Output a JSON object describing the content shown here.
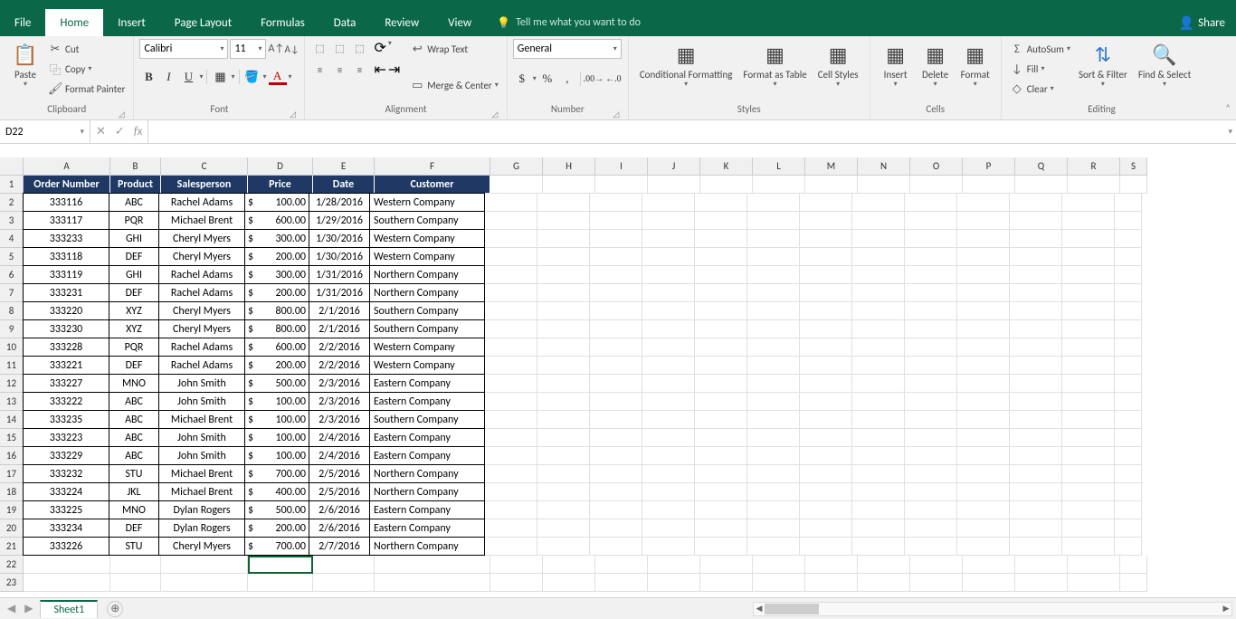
{
  "tabs": {
    "file": "File",
    "home": "Home",
    "insert": "Insert",
    "pagelayout": "Page Layout",
    "formulas": "Formulas",
    "data": "Data",
    "review": "Review",
    "view": "View",
    "tellme": "Tell me what you want to do",
    "share": "Share"
  },
  "ribbon": {
    "clipboard": {
      "paste": "Paste",
      "cut": "Cut",
      "copy": "Copy",
      "fp": "Format Painter",
      "label": "Clipboard"
    },
    "font": {
      "name": "Calibri",
      "size": "11",
      "label": "Font"
    },
    "alignment": {
      "wrap": "Wrap Text",
      "merge": "Merge & Center",
      "label": "Alignment"
    },
    "number": {
      "format": "General",
      "label": "Number"
    },
    "styles": {
      "cf": "Conditional Formatting",
      "fat": "Format as Table",
      "cs": "Cell Styles",
      "label": "Styles"
    },
    "cells": {
      "insert": "Insert",
      "delete": "Delete",
      "format": "Format",
      "label": "Cells"
    },
    "editing": {
      "autosum": "AutoSum",
      "fill": "Fill",
      "clear": "Clear",
      "sort": "Sort & Filter",
      "find": "Find & Select",
      "label": "Editing"
    }
  },
  "nameBox": "D22",
  "columns": [
    "A",
    "B",
    "C",
    "D",
    "E",
    "F",
    "G",
    "H",
    "I",
    "J",
    "K",
    "L",
    "M",
    "N",
    "O",
    "P",
    "Q",
    "R",
    "S"
  ],
  "colWidths": [
    "wA",
    "wB",
    "wC",
    "wD",
    "wE",
    "wF",
    "wG",
    "wH",
    "wI",
    "wJ",
    "wK",
    "wL",
    "wM",
    "wN",
    "wO",
    "wP",
    "wQ",
    "wR",
    "wS"
  ],
  "headers": [
    "Order Number",
    "Product",
    "Salesperson",
    "Price",
    "Date",
    "Customer"
  ],
  "rows": [
    {
      "n": "333116",
      "p": "ABC",
      "s": "Rachel Adams",
      "pr": "100.00",
      "d": "1/28/2016",
      "c": "Western Company"
    },
    {
      "n": "333117",
      "p": "PQR",
      "s": "Michael Brent",
      "pr": "600.00",
      "d": "1/29/2016",
      "c": "Southern Company"
    },
    {
      "n": "333233",
      "p": "GHI",
      "s": "Cheryl Myers",
      "pr": "300.00",
      "d": "1/30/2016",
      "c": "Western Company"
    },
    {
      "n": "333118",
      "p": "DEF",
      "s": "Cheryl Myers",
      "pr": "200.00",
      "d": "1/30/2016",
      "c": "Western Company"
    },
    {
      "n": "333119",
      "p": "GHI",
      "s": "Rachel Adams",
      "pr": "300.00",
      "d": "1/31/2016",
      "c": "Northern Company"
    },
    {
      "n": "333231",
      "p": "DEF",
      "s": "Rachel Adams",
      "pr": "200.00",
      "d": "1/31/2016",
      "c": "Northern Company"
    },
    {
      "n": "333220",
      "p": "XYZ",
      "s": "Cheryl Myers",
      "pr": "800.00",
      "d": "2/1/2016",
      "c": "Southern Company"
    },
    {
      "n": "333230",
      "p": "XYZ",
      "s": "Cheryl Myers",
      "pr": "800.00",
      "d": "2/1/2016",
      "c": "Southern Company"
    },
    {
      "n": "333228",
      "p": "PQR",
      "s": "Rachel Adams",
      "pr": "600.00",
      "d": "2/2/2016",
      "c": "Western Company"
    },
    {
      "n": "333221",
      "p": "DEF",
      "s": "Rachel Adams",
      "pr": "200.00",
      "d": "2/2/2016",
      "c": "Western Company"
    },
    {
      "n": "333227",
      "p": "MNO",
      "s": "John Smith",
      "pr": "500.00",
      "d": "2/3/2016",
      "c": "Eastern Company"
    },
    {
      "n": "333222",
      "p": "ABC",
      "s": "John Smith",
      "pr": "100.00",
      "d": "2/3/2016",
      "c": "Eastern Company"
    },
    {
      "n": "333235",
      "p": "ABC",
      "s": "Michael Brent",
      "pr": "100.00",
      "d": "2/3/2016",
      "c": "Southern Company"
    },
    {
      "n": "333223",
      "p": "ABC",
      "s": "John Smith",
      "pr": "100.00",
      "d": "2/4/2016",
      "c": "Eastern Company"
    },
    {
      "n": "333229",
      "p": "ABC",
      "s": "John Smith",
      "pr": "100.00",
      "d": "2/4/2016",
      "c": "Eastern Company"
    },
    {
      "n": "333232",
      "p": "STU",
      "s": "Michael Brent",
      "pr": "700.00",
      "d": "2/5/2016",
      "c": "Northern Company"
    },
    {
      "n": "333224",
      "p": "JKL",
      "s": "Michael Brent",
      "pr": "400.00",
      "d": "2/5/2016",
      "c": "Northern Company"
    },
    {
      "n": "333225",
      "p": "MNO",
      "s": "Dylan Rogers",
      "pr": "500.00",
      "d": "2/6/2016",
      "c": "Eastern Company"
    },
    {
      "n": "333234",
      "p": "DEF",
      "s": "Dylan Rogers",
      "pr": "200.00",
      "d": "2/6/2016",
      "c": "Eastern Company"
    },
    {
      "n": "333226",
      "p": "STU",
      "s": "Cheryl Myers",
      "pr": "700.00",
      "d": "2/7/2016",
      "c": "Northern Company"
    }
  ],
  "sheetTab": "Sheet1",
  "activeCell": {
    "row": 22,
    "col": "D"
  }
}
